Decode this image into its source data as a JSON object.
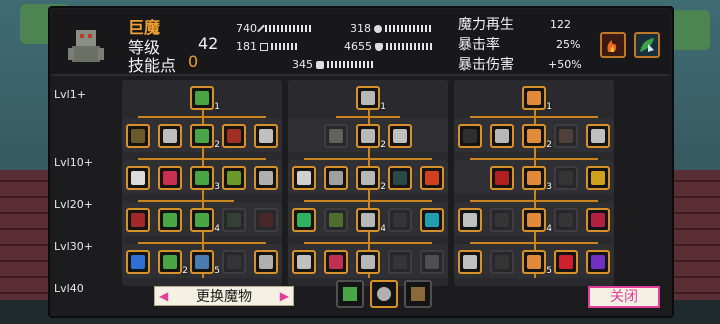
{
  "monster": {
    "name": "巨魔",
    "level_label": "等级",
    "level": "42",
    "skill_points_label": "技能点",
    "skill_points": "0"
  },
  "stats": {
    "attack": "740",
    "defense": "181",
    "speed": "345",
    "mana": "318",
    "health": "4655"
  },
  "right_stats": {
    "mana_regen_label": "魔力再生",
    "mana_regen": "122",
    "crit_rate_label": "暴击率",
    "crit_rate": "25%",
    "crit_dmg_label": "暴击伤害",
    "crit_dmg": "+50%"
  },
  "row_labels": [
    "Lvl1+",
    "Lvl10+",
    "Lvl20+",
    "Lvl30+",
    "Lvl40"
  ],
  "tree_levels": {
    "c0_top": "1",
    "c1_top": "1",
    "c2_top": "1",
    "c0_r1": "2",
    "c1_r1": "2",
    "c2_r1": "2",
    "c0_r2": "3",
    "c1_r2": "2",
    "c2_r2": "3",
    "c0_r3": "4",
    "c1_r3": "4",
    "c2_r3": "4",
    "c0_r4a": "2",
    "c0_r4b": "5",
    "c2_r4": "5"
  },
  "footer": {
    "swap_label": "更换魔物",
    "prev_arrow": "◀",
    "next_arrow": "▶",
    "close_label": "关闭"
  },
  "colors": {
    "accent_gold": "#d6912a",
    "name_orange": "#f0a030",
    "close_pink": "#e0409a"
  }
}
